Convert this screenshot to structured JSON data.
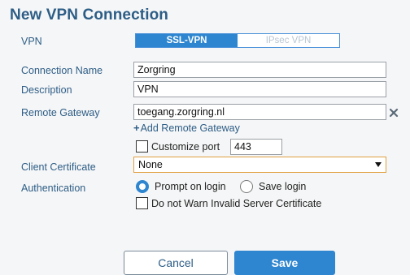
{
  "dialog": {
    "title": "New VPN Connection"
  },
  "vpn": {
    "label": "VPN",
    "options": [
      "SSL-VPN",
      "IPsec VPN"
    ],
    "selected": "SSL-VPN"
  },
  "connection_name": {
    "label": "Connection Name",
    "value": "Zorgring"
  },
  "description": {
    "label": "Description",
    "value": "VPN"
  },
  "remote_gateway": {
    "label": "Remote Gateway",
    "value": "toegang.zorgring.nl",
    "add_link": "Add Remote Gateway",
    "add_prefix": "+"
  },
  "customize_port": {
    "label": "Customize port",
    "checked": false,
    "value": "443"
  },
  "client_certificate": {
    "label": "Client Certificate",
    "selected": "None"
  },
  "authentication": {
    "label": "Authentication",
    "options": [
      "Prompt on login",
      "Save login"
    ],
    "selected": "Prompt on login"
  },
  "invalid_cert": {
    "label": "Do not Warn Invalid Server Certificate",
    "checked": false
  },
  "buttons": {
    "cancel": "Cancel",
    "save": "Save"
  },
  "colors": {
    "accent": "#2e86d0",
    "label_blue": "#2d5d86",
    "select_border": "#e0a040"
  },
  "icons": {
    "remove_gateway": "close-icon",
    "dropdown": "caret-down-icon",
    "add": "plus-icon"
  }
}
